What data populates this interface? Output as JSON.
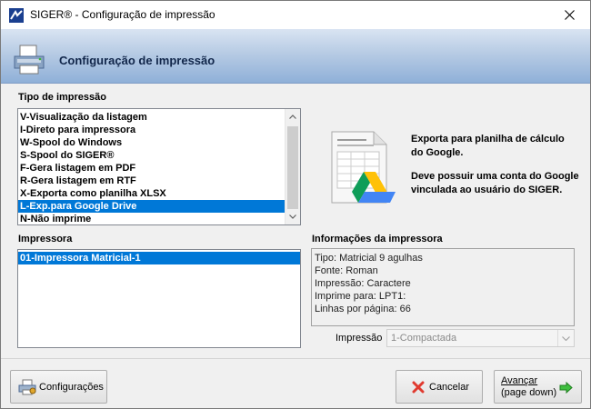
{
  "window": {
    "title": "SIGER® - Configuração de impressão"
  },
  "banner": {
    "title": "Configuração de impressão"
  },
  "tipo": {
    "label": "Tipo de impressão",
    "items": [
      "V-Visualização da listagem",
      "I-Direto para impressora",
      "W-Spool do Windows",
      "S-Spool do SIGER®",
      "F-Gera listagem em PDF",
      "R-Gera listagem em RTF",
      "X-Exporta como planilha XLSX",
      "L-Exp.para Google Drive",
      "N-Não imprime"
    ],
    "selected_index": 7
  },
  "description": {
    "line1": "Exporta para planilha de cálculo do Google.",
    "line2": "Deve possuir uma conta do Google vinculada ao usuário do SIGER."
  },
  "impressora": {
    "label": "Impressora",
    "items": [
      "01-Impressora Matricial-1"
    ],
    "selected_index": 0
  },
  "informacoes": {
    "label": "Informações da impressora",
    "lines": [
      "Tipo: Matricial 9 agulhas",
      "Fonte: Roman",
      "Impressão: Caractere",
      "Imprime para: LPT1:",
      "Linhas por página: 66"
    ]
  },
  "impressao_select": {
    "label": "Impressão",
    "value": "1-Compactada"
  },
  "buttons": {
    "configuracoes": "Configurações",
    "cancelar": "Cancelar",
    "avancar_line1": "Avançar",
    "avancar_line2": "(page down)"
  },
  "colors": {
    "selection": "#0078d7",
    "banner_dark": "#8fb0d8",
    "banner_title": "#11264a"
  }
}
